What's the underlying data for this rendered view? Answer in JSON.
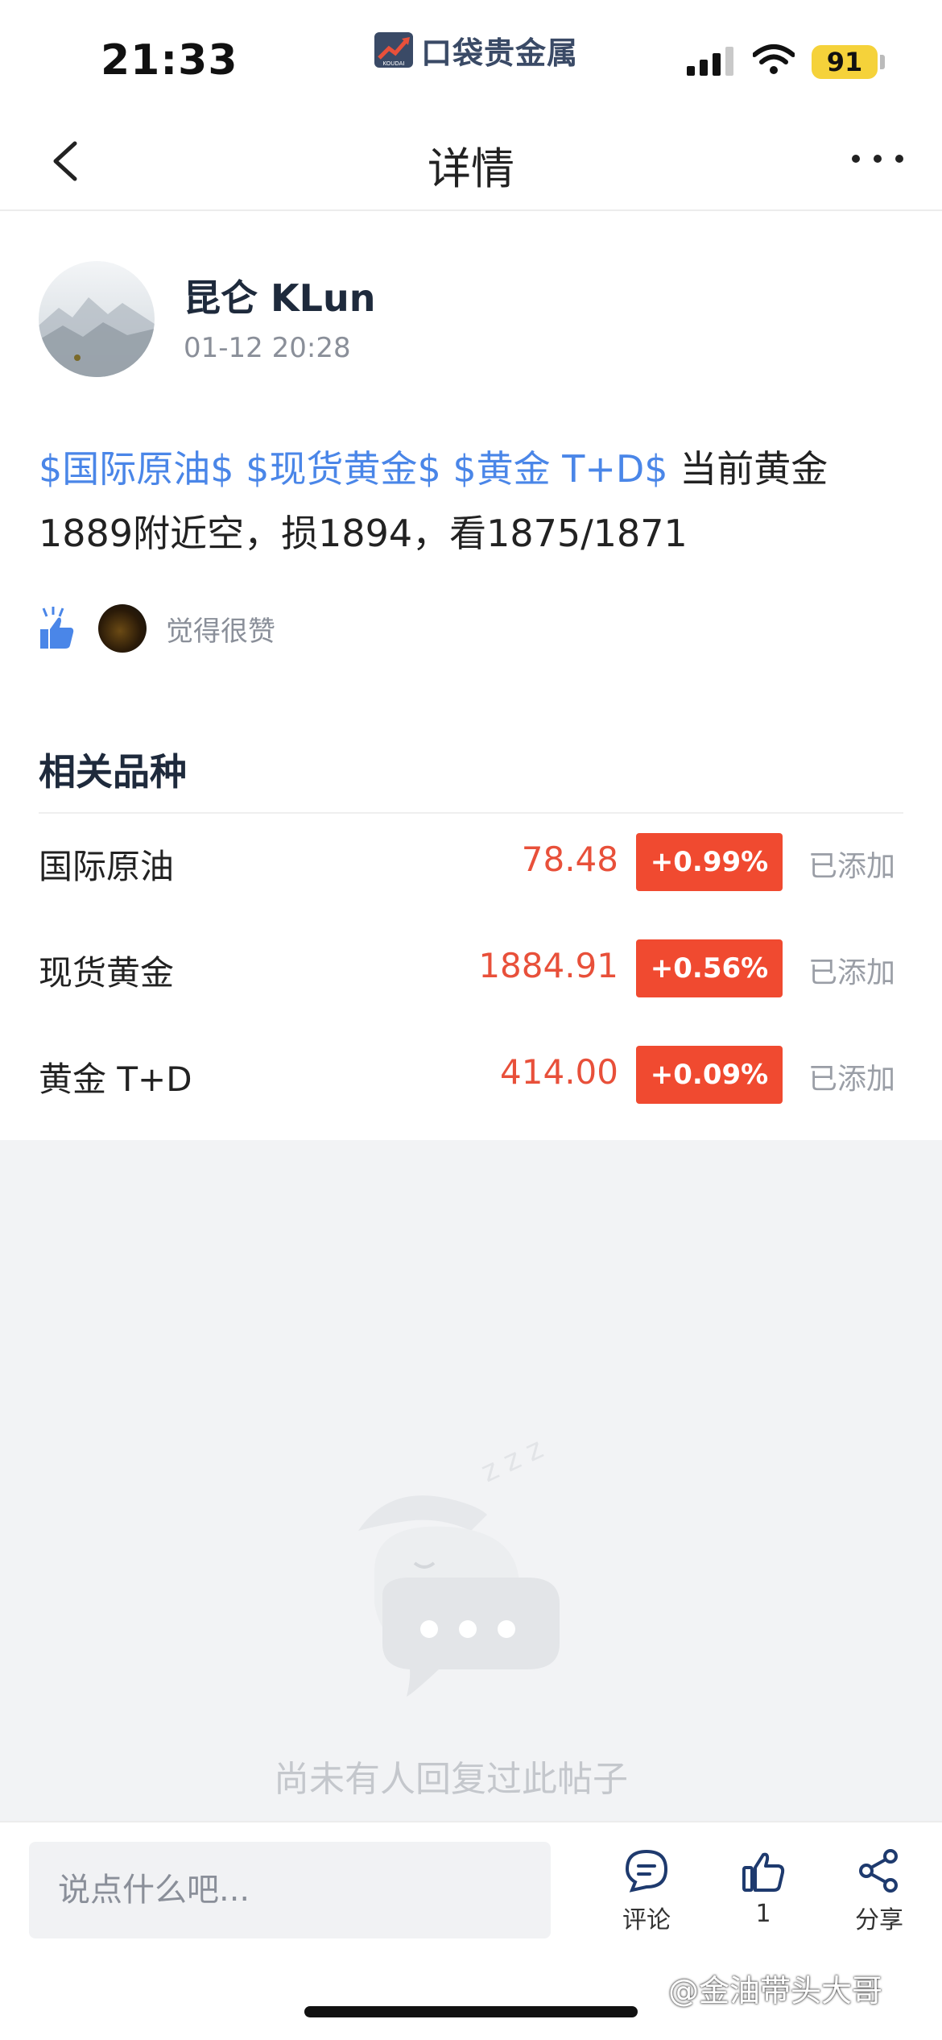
{
  "status_bar": {
    "time": "21:33",
    "app_name": "口袋贵金属",
    "app_logo_text": "KOUDAI",
    "battery": "91",
    "icons": [
      "signal-icon",
      "wifi-icon",
      "battery-icon"
    ]
  },
  "nav": {
    "title": "详情",
    "back_icon": "chevron-left-icon",
    "more_icon": "more-dots-icon"
  },
  "post": {
    "author": "昆仑 KLun",
    "time": "01-12 20:28",
    "tags": [
      "$国际原油$",
      "$现货黄金$",
      "$黄金 T+D$"
    ],
    "text": "当前黄金1889附近空，损1894，看1875/1871",
    "likes_text": "觉得很赞"
  },
  "related": {
    "title": "相关品种",
    "items": [
      {
        "name": "国际原油",
        "price": "78.48",
        "change": "+0.99%",
        "status": "已添加"
      },
      {
        "name": "现货黄金",
        "price": "1884.91",
        "change": "+0.56%",
        "status": "已添加"
      },
      {
        "name": "黄金 T+D",
        "price": "414.00",
        "change": "+0.09%",
        "status": "已添加"
      }
    ]
  },
  "empty_state": {
    "text": "尚未有人回复过此帖子",
    "icon": "sleeping-chat-bubble-icon"
  },
  "bottom_bar": {
    "input_placeholder": "说点什么吧...",
    "comment_label": "评论",
    "like_count": "1",
    "share_label": "分享"
  },
  "watermark": "@金油带头大哥",
  "colors": {
    "tag_blue": "#4a86e8",
    "price_red": "#e8503a",
    "change_bg": "#f04a30",
    "author_navy": "#1e2a3c"
  }
}
